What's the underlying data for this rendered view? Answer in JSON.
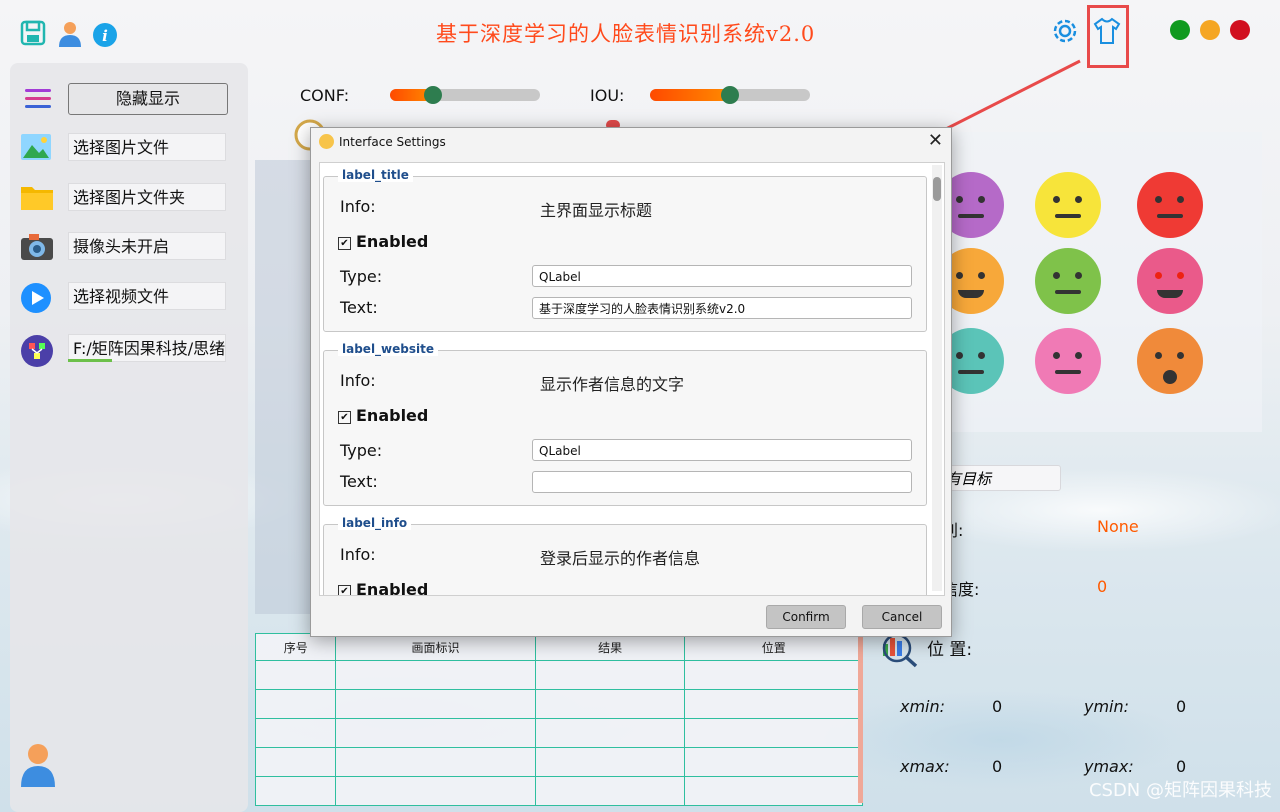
{
  "app": {
    "title": "基于深度学习的人脸表情识别系统v2.0",
    "colors": {
      "title": "#ff4a1c",
      "accent": "#ff5a00",
      "close": "#d10f1f",
      "min": "#f5a623",
      "max": "#109a1f"
    }
  },
  "toolbar": {
    "icons": [
      "save-icon",
      "user-icon",
      "info-icon",
      "settings-gear-icon",
      "theme-shirt-icon"
    ]
  },
  "sidebar": {
    "toggle_label": "隐藏显示",
    "items": [
      {
        "label": "选择图片文件",
        "icon": "image-icon"
      },
      {
        "label": "选择图片文件夹",
        "icon": "folder-icon"
      },
      {
        "label": "摄像头未开启",
        "icon": "camera-icon"
      },
      {
        "label": "选择视频文件",
        "icon": "play-icon"
      },
      {
        "label": "F:/矩阵因果科技/思绪",
        "icon": "model-icon"
      }
    ]
  },
  "sliders": {
    "conf_label": "CONF:",
    "conf_value": 0.25,
    "iou_label": "IOU:",
    "iou_value": 0.5
  },
  "results": {
    "target_select": "有目标",
    "category_label": "别:",
    "category_value": "None",
    "confidence_label": "信度:",
    "confidence_value": "0",
    "position_label": "位 置:",
    "xmin_label": "xmin:",
    "xmin": "0",
    "ymin_label": "ymin:",
    "ymin": "0",
    "xmax_label": "xmax:",
    "xmax": "0",
    "ymax_label": "ymax:",
    "ymax": "0"
  },
  "table": {
    "headers": [
      "序号",
      "画面标识",
      "结果",
      "位置"
    ],
    "rows": 5
  },
  "dialog": {
    "title": "Interface Settings",
    "groups": [
      {
        "name": "label_title",
        "info_label": "Info:",
        "info": "主界面显示标题",
        "enabled": "Enabled",
        "type_label": "Type:",
        "type": "QLabel",
        "text_label": "Text:",
        "text": "基于深度学习的人脸表情识别系统v2.0"
      },
      {
        "name": "label_website",
        "info_label": "Info:",
        "info": "显示作者信息的文字",
        "enabled": "Enabled",
        "type_label": "Type:",
        "type": "QLabel",
        "text_label": "Text:",
        "text": ""
      },
      {
        "name": "label_info",
        "info_label": "Info:",
        "info": "登录后显示的作者信息",
        "enabled": "Enabled"
      }
    ],
    "confirm_label": "Confirm",
    "cancel_label": "Cancel"
  },
  "watermark": "CSDN @矩阵因果科技"
}
